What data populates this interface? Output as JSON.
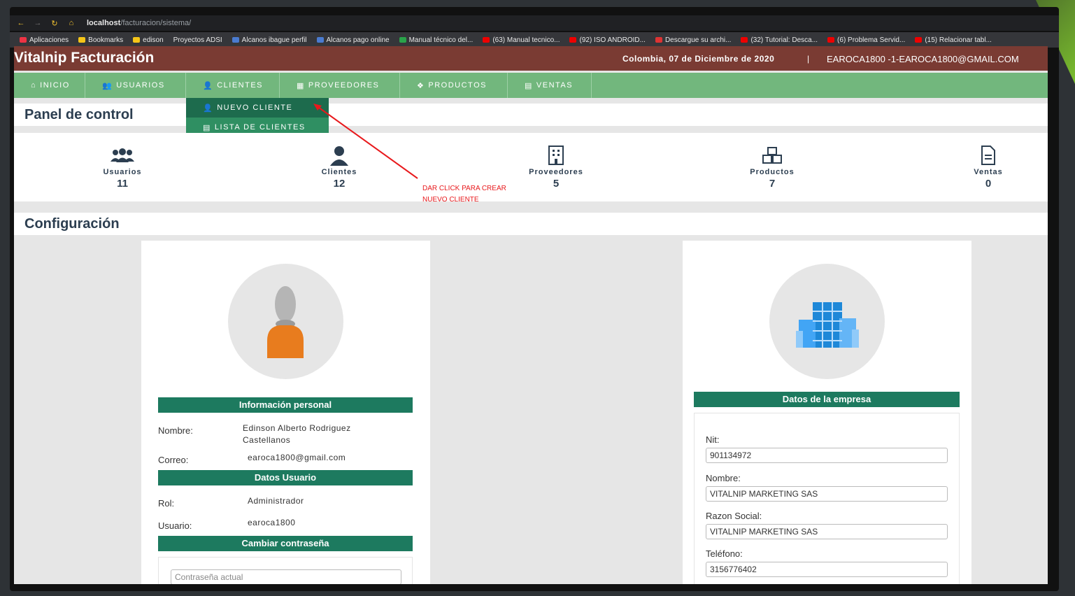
{
  "browser": {
    "url_host": "localhost",
    "url_path": "/facturacion/sistema/",
    "bookmarks": [
      "Aplicaciones",
      "Bookmarks",
      "edison",
      "Proyectos ADSI",
      "Alcanos ibague perfil",
      "Alcanos pago online",
      "Manual técnico del...",
      "(63) Manual tecnico...",
      "(92) ISO ANDROID...",
      "Descargue su archi...",
      "(32) Tutorial: Desca...",
      "(6) Problema Servid...",
      "(15) Relacionar tabl..."
    ]
  },
  "header": {
    "brand": "Vitalnip Facturación",
    "date": "Colombia, 07 de Diciembre de 2020",
    "separator": "|",
    "user": "EAROCA1800 -1-EAROCA1800@GMAIL.COM"
  },
  "menu": {
    "items": [
      "INICIO",
      "USUARIOS",
      "CLIENTES",
      "PROVEEDORES",
      "PRODUCTOS",
      "VENTAS"
    ],
    "dropdown": [
      "NUEVO CLIENTE",
      "LISTA DE CLIENTES"
    ]
  },
  "panel_title": "Panel de control",
  "stats": [
    {
      "label": "Usuarios",
      "value": "11"
    },
    {
      "label": "Clientes",
      "value": "12"
    },
    {
      "label": "Proveedores",
      "value": "5"
    },
    {
      "label": "Productos",
      "value": "7"
    },
    {
      "label": "Ventas",
      "value": "0"
    }
  ],
  "annotation": [
    "DAR CLICK PARA CREAR",
    "NUEVO CLIENTE"
  ],
  "config_title": "Configuración",
  "personal": {
    "title": "Información personal",
    "nombre_label": "Nombre:",
    "nombre_value": "Edinson Alberto Rodriguez Castellanos",
    "correo_label": "Correo:",
    "correo_value": "earoca1800@gmail.com",
    "user_title": "Datos Usuario",
    "rol_label": "Rol:",
    "rol_value": "Administrador",
    "usuario_label": "Usuario:",
    "usuario_value": "earoca1800",
    "password_title": "Cambiar contraseña",
    "password_placeholder": "Contraseña actual"
  },
  "empresa": {
    "title": "Datos de la empresa",
    "nit_label": "Nit:",
    "nit_value": "901134972",
    "nombre_label": "Nombre:",
    "nombre_value": "VITALNIP MARKETING SAS",
    "razon_label": "Razon Social:",
    "razon_value": "VITALNIP MARKETING SAS",
    "telefono_label": "Teléfono:",
    "telefono_value": "3156776402"
  },
  "colors": {
    "topbar": "#7a3b33",
    "menu": "#72b77d",
    "dropdown": "#2f8f62",
    "section_bar": "#1d7a5f",
    "annotation": "#e8191c"
  }
}
